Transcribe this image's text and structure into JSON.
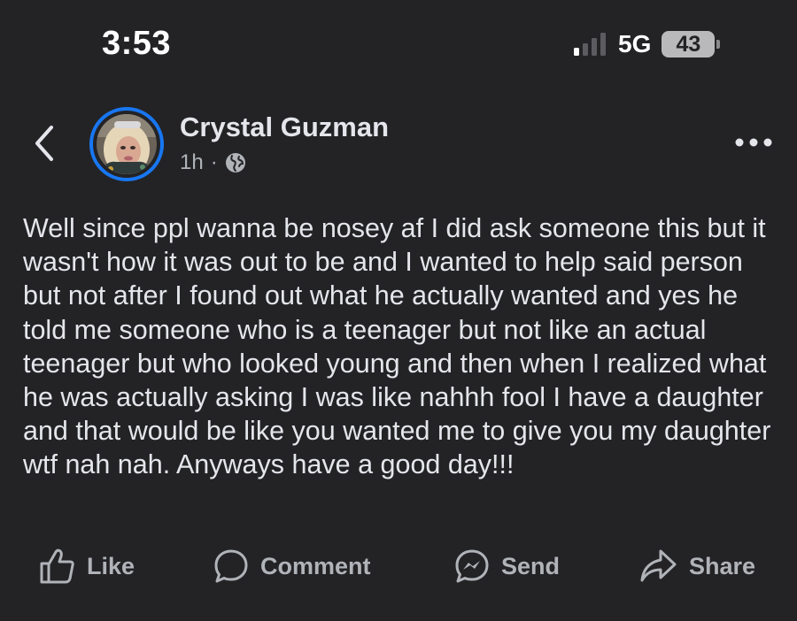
{
  "status_bar": {
    "time": "3:53",
    "network": "5G",
    "battery": "43"
  },
  "post": {
    "author": "Crystal Guzman",
    "time_ago": "1h",
    "separator": "·",
    "body": "Well since ppl wanna be nosey af I did ask someone this but it wasn't how it was out to be and I wanted to help said person but not after I found out what he actually wanted and yes he told me someone who is a teenager but not like an actual teenager but who looked young and then when I realized what he was actually asking I was like nahhh fool I have a daughter and that would be like you wanted me to give you my daughter wtf nah nah. Anyways have a good day!!!"
  },
  "actions": {
    "like": "Like",
    "comment": "Comment",
    "send": "Send",
    "share": "Share"
  },
  "icons": {
    "back": "chevron-left-icon",
    "privacy": "globe-icon",
    "more": "more-dots-icon",
    "like": "thumbs-up-icon",
    "comment": "comment-bubble-icon",
    "send": "messenger-icon",
    "share": "share-arrow-icon"
  },
  "colors": {
    "background": "#232326",
    "text": "#e4e6eb",
    "secondary_text": "#b0b3b8",
    "avatar_ring": "#1877f2"
  }
}
